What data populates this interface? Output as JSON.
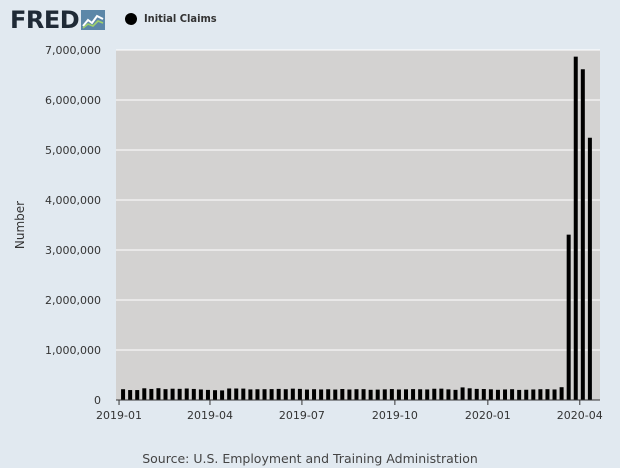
{
  "header": {
    "logo_text": "FRED",
    "logo_icon": "line-graph-icon",
    "legend_label": "Initial Claims",
    "legend_color": "#000000"
  },
  "source_text": "Source: U.S. Employment and Training Administration",
  "chart_data": {
    "type": "bar",
    "title": "",
    "xlabel": "",
    "ylabel": "Number",
    "ylim": [
      0,
      7000000
    ],
    "yticks": [
      0,
      1000000,
      2000000,
      3000000,
      4000000,
      5000000,
      6000000,
      7000000
    ],
    "ytick_labels": [
      "0",
      "1,000,000",
      "2,000,000",
      "3,000,000",
      "4,000,000",
      "5,000,000",
      "6,000,000",
      "7,000,000"
    ],
    "xlim": [
      "2018-12-29",
      "2020-04-21"
    ],
    "xticks": [
      "2019-01-01",
      "2019-04-01",
      "2019-07-01",
      "2019-10-01",
      "2020-01-01",
      "2020-04-01"
    ],
    "xtick_labels": [
      "2019-01",
      "2019-04",
      "2019-07",
      "2019-10",
      "2020-01",
      "2020-04"
    ],
    "grid": true,
    "legend": "top-left",
    "bar_color": "#000000",
    "plot_background": "#d3d2d1",
    "series": [
      {
        "name": "Initial Claims",
        "x": [
          "2019-01-05",
          "2019-01-12",
          "2019-01-19",
          "2019-01-26",
          "2019-02-02",
          "2019-02-09",
          "2019-02-16",
          "2019-02-23",
          "2019-03-02",
          "2019-03-09",
          "2019-03-16",
          "2019-03-23",
          "2019-03-30",
          "2019-04-06",
          "2019-04-13",
          "2019-04-20",
          "2019-04-27",
          "2019-05-04",
          "2019-05-11",
          "2019-05-18",
          "2019-05-25",
          "2019-06-01",
          "2019-06-08",
          "2019-06-15",
          "2019-06-22",
          "2019-06-29",
          "2019-07-06",
          "2019-07-13",
          "2019-07-20",
          "2019-07-27",
          "2019-08-03",
          "2019-08-10",
          "2019-08-17",
          "2019-08-24",
          "2019-08-31",
          "2019-09-07",
          "2019-09-14",
          "2019-09-21",
          "2019-09-28",
          "2019-10-05",
          "2019-10-12",
          "2019-10-19",
          "2019-10-26",
          "2019-11-02",
          "2019-11-09",
          "2019-11-16",
          "2019-11-23",
          "2019-11-30",
          "2019-12-07",
          "2019-12-14",
          "2019-12-21",
          "2019-12-28",
          "2020-01-04",
          "2020-01-11",
          "2020-01-18",
          "2020-01-25",
          "2020-02-01",
          "2020-02-08",
          "2020-02-15",
          "2020-02-22",
          "2020-02-29",
          "2020-03-07",
          "2020-03-14",
          "2020-03-21",
          "2020-03-28",
          "2020-04-04",
          "2020-04-11"
        ],
        "values": [
          216000,
          199000,
          199000,
          234000,
          221000,
          236000,
          217000,
          226000,
          223000,
          230000,
          221000,
          211000,
          202000,
          196000,
          192000,
          230000,
          230000,
          228000,
          212000,
          215000,
          216000,
          218000,
          222000,
          216000,
          227000,
          222000,
          209000,
          216000,
          211000,
          215000,
          209000,
          220000,
          210000,
          216000,
          217000,
          204000,
          208000,
          213000,
          219000,
          210000,
          214000,
          218000,
          215000,
          211000,
          225000,
          227000,
          213000,
          203000,
          252000,
          234000,
          222000,
          220000,
          214000,
          204000,
          211000,
          216000,
          202000,
          205000,
          211000,
          216000,
          217000,
          211000,
          256000,
          3307000,
          6867000,
          6615000,
          5245000
        ]
      }
    ]
  }
}
